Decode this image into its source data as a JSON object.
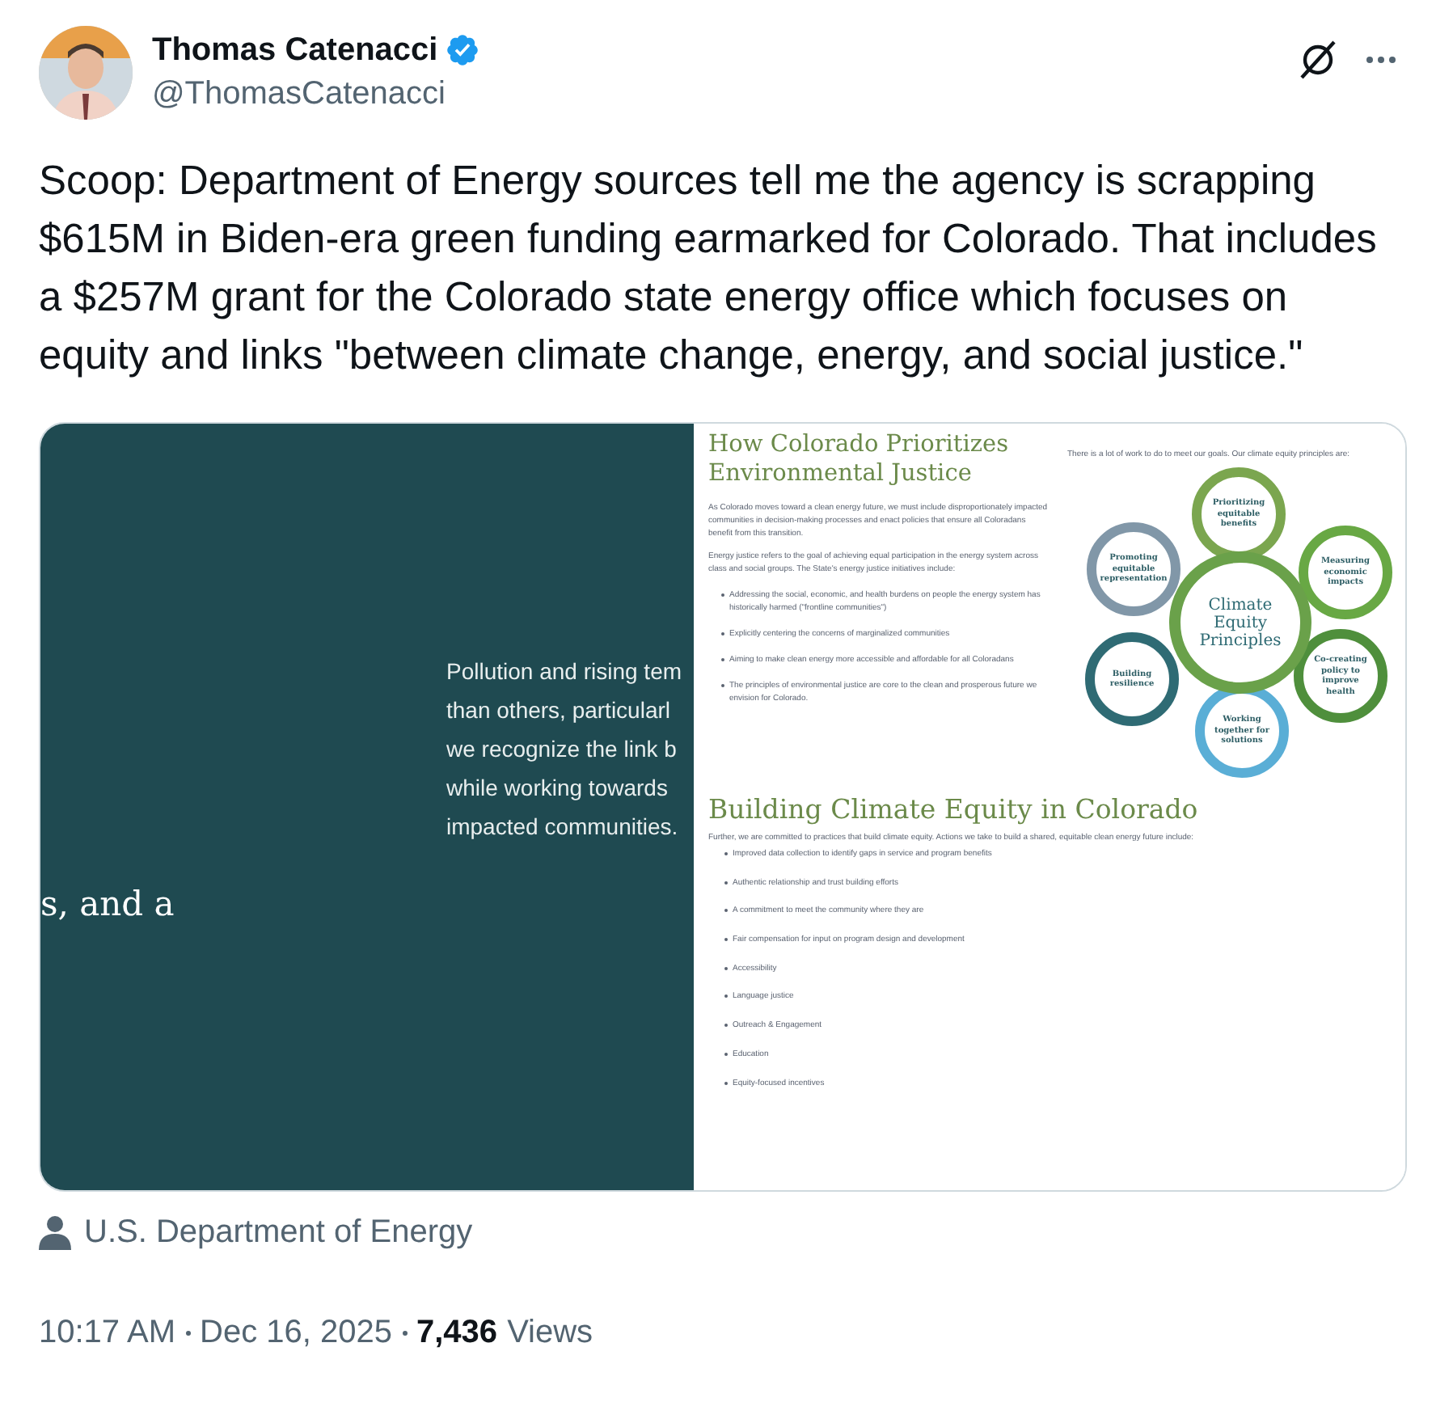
{
  "author": {
    "name": "Thomas Catenacci",
    "handle": "@ThomasCatenacci",
    "verified": true
  },
  "tweet_text": "Scoop: Department of Energy sources tell me the agency is scrapping $615M in Biden-era green funding earmarked for Colorado. That includes a $257M grant for the Colorado state energy office which focuses on equity and links \"between climate change, energy, and social justice.\"",
  "media": {
    "slide": {
      "lines": [
        "Pollution and rising tem",
        "than others, particularl",
        "we recognize the link b",
        "while working towards",
        "impacted communities."
      ],
      "fragment": "s, and a"
    },
    "document": {
      "title": "How Colorado Prioritizes Environmental Justice",
      "paragraphs": [
        "As Colorado moves toward a clean energy future, we must include disproportionately impacted communities in decision-making processes and enact policies that ensure all Coloradans benefit from this transition.",
        "Energy justice refers to the goal of achieving equal participation in the energy system across class and social groups. The State's energy justice initiatives include:"
      ],
      "bullets": [
        "Addressing the social, economic, and health burdens on people the energy system has historically harmed (\"frontline communities\")",
        "Explicitly centering the concerns of marginalized communities",
        "Aiming to make clean energy more accessible and affordable for all Coloradans",
        "The principles of environmental justice are core to the clean and prosperous future we envision for Colorado."
      ],
      "diagram_intro": "There is a lot of work to do to meet our goals. Our climate equity principles are:",
      "diagram": {
        "center": "Climate Equity Principles",
        "nodes": [
          {
            "label": "Prioritizing equitable benefits",
            "color": "#7ba64f"
          },
          {
            "label": "Promoting equitable representation",
            "color": "#8197a8"
          },
          {
            "label": "Measuring economic impacts",
            "color": "#68a844"
          },
          {
            "label": "Building resilience",
            "color": "#2f6b74"
          },
          {
            "label": "Co-creating policy to improve health",
            "color": "#4f8f3c"
          },
          {
            "label": "Working together for solutions",
            "color": "#5aaed6"
          }
        ]
      },
      "section_title": "Building Climate Equity in Colorado",
      "section_intro": "Further, we are committed to practices that build climate equity. Actions we take to build a shared, equitable clean energy future include:",
      "section_bullets": [
        "Improved data collection to identify gaps in service and program benefits",
        "Authentic relationship and trust building efforts",
        "A commitment to meet the community where they are",
        "Fair compensation for input on program design and development",
        "Accessibility",
        "Language justice",
        "Outreach & Engagement",
        "Education",
        "Equity-focused incentives"
      ]
    }
  },
  "source": "U.S. Department of Energy",
  "meta": {
    "time": "10:17 AM",
    "date": "Dec 16, 2025",
    "views_count": "7,436",
    "views_label": "Views"
  }
}
